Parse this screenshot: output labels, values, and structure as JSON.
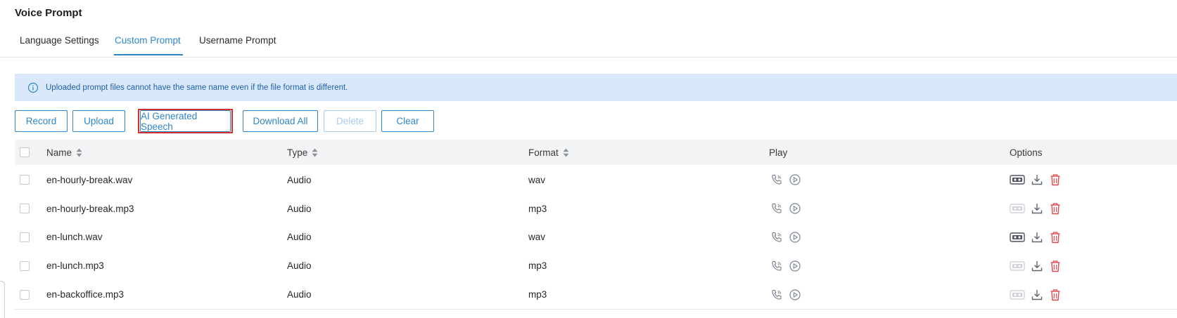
{
  "page": {
    "title": "Voice Prompt"
  },
  "tabs": [
    {
      "label": "Language Settings",
      "active": false
    },
    {
      "label": "Custom Prompt",
      "active": true
    },
    {
      "label": "Username Prompt",
      "active": false
    }
  ],
  "notice": {
    "icon": "info-icon",
    "text": "Uploaded prompt files cannot have the same name even if the file format is different."
  },
  "toolbar": {
    "record": "Record",
    "upload": "Upload",
    "ai_speech": "AI Generated Speech",
    "download_all": "Download All",
    "delete": "Delete",
    "clear": "Clear"
  },
  "table": {
    "columns": {
      "name": "Name",
      "type": "Type",
      "format": "Format",
      "play": "Play",
      "options": "Options"
    },
    "rows": [
      {
        "name": "en-hourly-break.wav",
        "type": "Audio",
        "format": "wav",
        "convert_enabled": true
      },
      {
        "name": "en-hourly-break.mp3",
        "type": "Audio",
        "format": "mp3",
        "convert_enabled": false
      },
      {
        "name": "en-lunch.wav",
        "type": "Audio",
        "format": "wav",
        "convert_enabled": true
      },
      {
        "name": "en-lunch.mp3",
        "type": "Audio",
        "format": "mp3",
        "convert_enabled": false
      },
      {
        "name": "en-backoffice.mp3",
        "type": "Audio",
        "format": "mp3",
        "convert_enabled": false
      }
    ]
  },
  "colors": {
    "accent": "#2e86c9",
    "notice_bg": "#d9e9fb",
    "highlight": "#d22f2f",
    "delete_icon": "#e0484f",
    "icon_gray": "#7b8591"
  }
}
